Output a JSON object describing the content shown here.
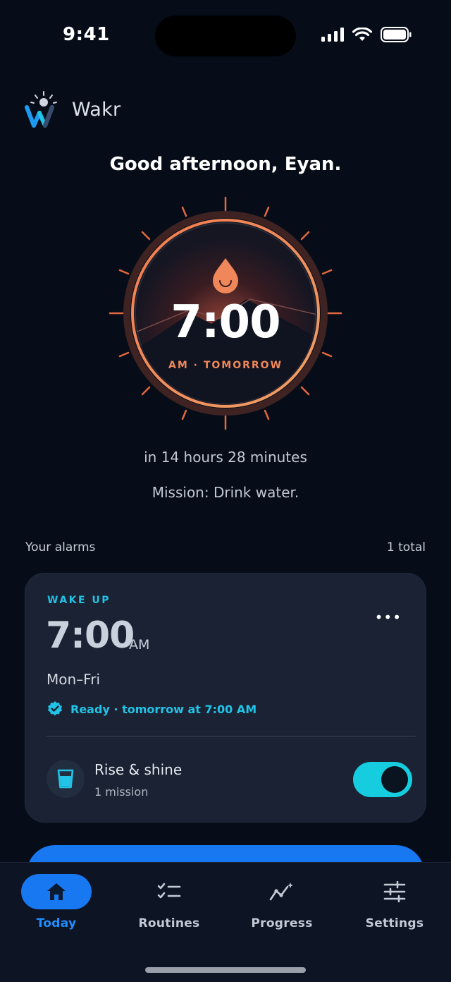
{
  "status_bar": {
    "time": "9:41"
  },
  "brand": {
    "name": "Wakr"
  },
  "greeting": "Good afternoon, Eyan.",
  "next_alarm": {
    "time": "7:00",
    "subtitle": "AM · TOMORROW",
    "countdown": "in 14 hours 28 minutes",
    "mission": "Mission: Drink water."
  },
  "alarms_section": {
    "title": "Your alarms",
    "count": "1 total"
  },
  "alarm_card": {
    "label": "WAKE UP",
    "more": "•••",
    "time": "7:00",
    "ampm": "AM",
    "days": "Mon–Fri",
    "status": "Ready · tomorrow at 7:00 AM",
    "routine_name": "Rise & shine",
    "routine_sub": "1 mission",
    "enabled": true
  },
  "tabs": [
    {
      "label": "Today",
      "icon": "home-icon",
      "active": true
    },
    {
      "label": "Routines",
      "icon": "checklist-icon",
      "active": false
    },
    {
      "label": "Progress",
      "icon": "progress-chart-icon",
      "active": false
    },
    {
      "label": "Settings",
      "icon": "sliders-icon",
      "active": false
    }
  ],
  "colors": {
    "background": "#070d18",
    "accent_cyan": "#22c3e6",
    "accent_blue": "#1778f2",
    "sun_orange": "#f0875a",
    "card": "#1a2233"
  }
}
